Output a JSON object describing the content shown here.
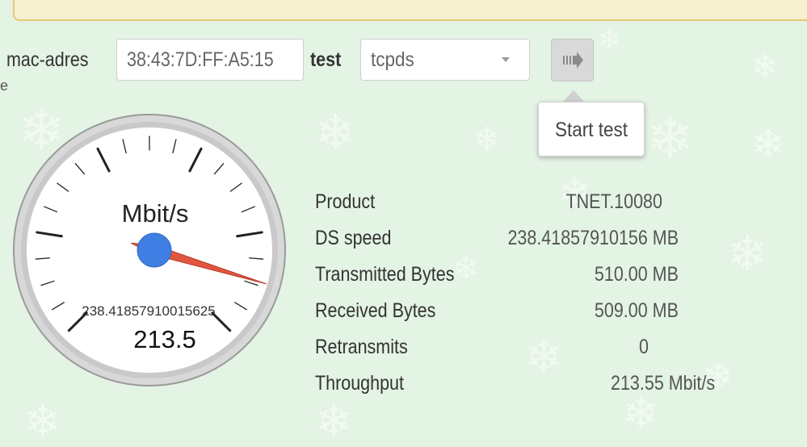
{
  "form": {
    "mac_label": "mac-adres",
    "mac_wrap_char": "e",
    "mac_value": "38:43:7D:FF:A5:15",
    "test_label": "test",
    "test_selected": "tcpds",
    "start_tooltip": "Start test"
  },
  "gauge": {
    "unit": "Mbit/s",
    "max_label": "238.41857910015625",
    "current_value": "213.5",
    "needle_fraction": 0.8956,
    "colors": {
      "face": "#ffffff",
      "rim": "#c9c9c9",
      "needle": "#e0563f",
      "hub": "#3f7fe3"
    }
  },
  "stats": {
    "rows": [
      {
        "label": "Product",
        "value": "TNET.10080"
      },
      {
        "label": "DS speed",
        "value": "238.41857910156 MB"
      },
      {
        "label": "Transmitted Bytes",
        "value": "510.00 MB"
      },
      {
        "label": "Received Bytes",
        "value": "509.00 MB"
      },
      {
        "label": "Retransmits",
        "value": "0"
      },
      {
        "label": "Throughput",
        "value": "213.55 Mbit/s"
      }
    ]
  },
  "icons": {
    "start": "arrow-right-icon",
    "background": "snowflake-icon"
  },
  "colors": {
    "background": "#e3f3e4",
    "banner_border": "#e8c773",
    "banner_fill": "#f7f1cf"
  }
}
